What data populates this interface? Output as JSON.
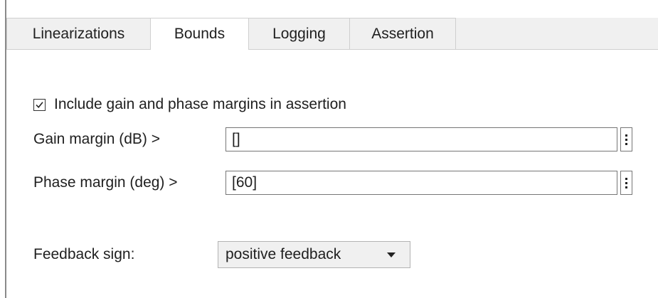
{
  "tabs": [
    {
      "label": "Linearizations",
      "active": false
    },
    {
      "label": "Bounds",
      "active": true
    },
    {
      "label": "Logging",
      "active": false
    },
    {
      "label": "Assertion",
      "active": false
    }
  ],
  "assertion_checkbox": {
    "label": "Include gain and phase margins in assertion",
    "checked": true
  },
  "gain_margin": {
    "label": "Gain margin (dB) >",
    "value": "[]"
  },
  "phase_margin": {
    "label": "Phase margin (deg) >",
    "value": "[60]"
  },
  "feedback_sign": {
    "label": "Feedback sign:",
    "selected": "positive feedback"
  },
  "icons": {
    "checkbox": "check-icon",
    "menu": "vertical-ellipsis-icon",
    "dropdown": "caret-down-icon"
  }
}
